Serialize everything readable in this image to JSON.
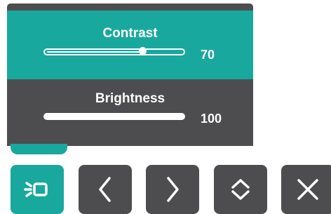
{
  "osd": {
    "contrast": {
      "label": "Contrast",
      "value": "70",
      "level": 0.7
    },
    "brightness": {
      "label": "Brightness",
      "value": "100",
      "level": 1.0
    }
  },
  "buttons": [
    {
      "icon": "input-source-icon",
      "active": true
    },
    {
      "icon": "chevron-left-icon",
      "active": false
    },
    {
      "icon": "chevron-right-icon",
      "active": false
    },
    {
      "icon": "up-down-icon",
      "active": false
    },
    {
      "icon": "close-icon",
      "active": false
    }
  ],
  "colors": {
    "accent": "#19a89d",
    "panel": "#4d4d4f",
    "text": "#ffffff"
  }
}
